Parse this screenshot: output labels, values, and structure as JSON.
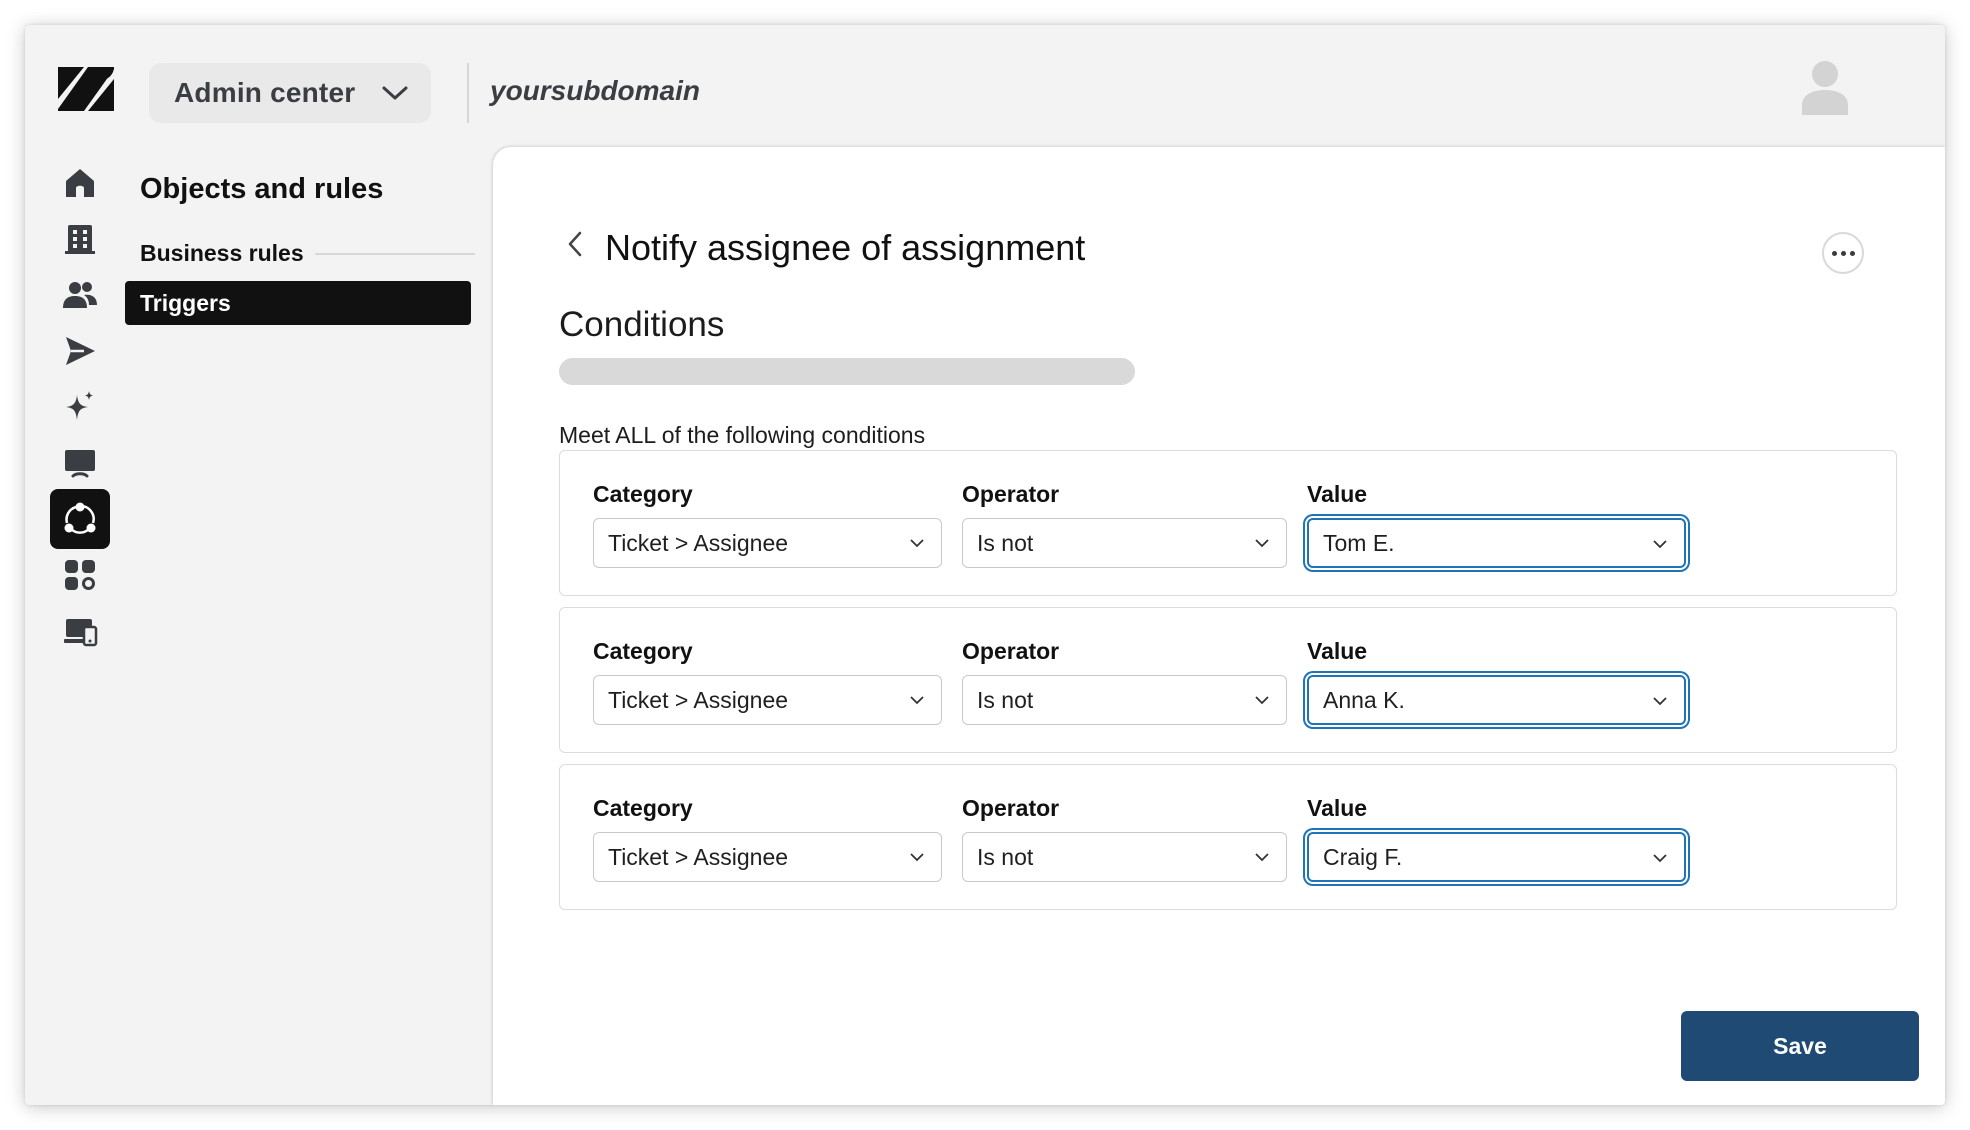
{
  "header": {
    "product_switcher_label": "Admin center",
    "subdomain": "yoursubdomain"
  },
  "rail": {
    "icons": [
      "home-icon",
      "building-icon",
      "people-icon",
      "send-icon",
      "sparkle-icon",
      "monitor-icon",
      "objects-rules-icon",
      "apps-icon",
      "workspace-icon"
    ],
    "active_index": 6
  },
  "nav": {
    "title": "Objects and rules",
    "section": "Business rules",
    "active_item": "Triggers"
  },
  "main": {
    "page_title": "Notify assignee of assignment",
    "section_title": "Conditions",
    "meet_all_text": "Meet ALL of the following conditions",
    "labels": {
      "category": "Category",
      "operator": "Operator",
      "value": "Value"
    },
    "conditions": [
      {
        "category": "Ticket > Assignee",
        "operator": "Is not",
        "value": "Tom E."
      },
      {
        "category": "Ticket > Assignee",
        "operator": "Is not",
        "value": "Anna K."
      },
      {
        "category": "Ticket > Assignee",
        "operator": "Is not",
        "value": "Craig F."
      }
    ],
    "save_label": "Save"
  },
  "colors": {
    "primary_button": "#1e4a73",
    "focus_ring": "#1f73b7",
    "active_nav": "#111111"
  }
}
